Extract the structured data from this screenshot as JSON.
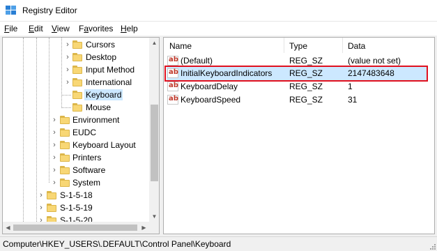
{
  "window": {
    "title": "Registry Editor",
    "icon": "registry-editor-icon"
  },
  "menu": [
    {
      "underline": "F",
      "rest": "ile"
    },
    {
      "underline": "E",
      "rest": "dit"
    },
    {
      "underline": "V",
      "rest": "iew"
    },
    {
      "underline": "",
      "pre": "F",
      "mid": "a",
      "rest": "vorites"
    },
    {
      "underline": "H",
      "rest": "elp"
    }
  ],
  "tree": {
    "children": [
      "Cursors",
      "Desktop",
      "Input Method",
      "International",
      "Keyboard",
      "Mouse"
    ],
    "siblings": [
      "Environment",
      "EUDC",
      "Keyboard Layout",
      "Printers",
      "Software",
      "System"
    ],
    "sids": [
      "S-1-5-18",
      "S-1-5-19",
      "S-1-5-20"
    ],
    "selected": "Keyboard"
  },
  "values": {
    "headers": {
      "name": "Name",
      "type": "Type",
      "data": "Data"
    },
    "rows": [
      {
        "name": "(Default)",
        "type": "REG_SZ",
        "data": "(value not set)"
      },
      {
        "name": "InitialKeyboardIndicators",
        "type": "REG_SZ",
        "data": "2147483648"
      },
      {
        "name": "KeyboardDelay",
        "type": "REG_SZ",
        "data": "1"
      },
      {
        "name": "KeyboardSpeed",
        "type": "REG_SZ",
        "data": "31"
      }
    ],
    "icon": "ab",
    "selected_index": 1
  },
  "status": {
    "path": "Computer\\HKEY_USERS\\.DEFAULT\\Control Panel\\Keyboard"
  },
  "colors": {
    "selection": "#cce8ff",
    "highlight_border": "#e0101e",
    "folder": "#f8d775",
    "string_icon_text": "#c0392b"
  }
}
